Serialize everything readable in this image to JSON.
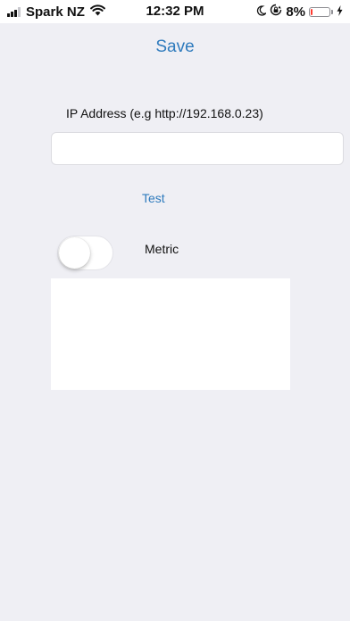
{
  "status_bar": {
    "carrier": "Spark NZ",
    "time": "12:32 PM",
    "battery_percent": "8%",
    "battery_level": 0.08,
    "signal_bars": 3,
    "icons": [
      "signal-icon",
      "wifi-icon",
      "moon-icon",
      "rotation-lock-icon",
      "battery-icon",
      "charging-bolt-icon"
    ]
  },
  "header": {
    "save_label": "Save"
  },
  "form": {
    "ip_label": "IP Address (e.g http://192.168.0.23)",
    "ip_value": "",
    "ip_placeholder": "",
    "test_label": "Test",
    "metric_label": "Metric",
    "metric_on": false
  },
  "colors": {
    "accent": "#2f7bbd",
    "background": "#efeff4",
    "battery_low": "#ff3b30"
  }
}
